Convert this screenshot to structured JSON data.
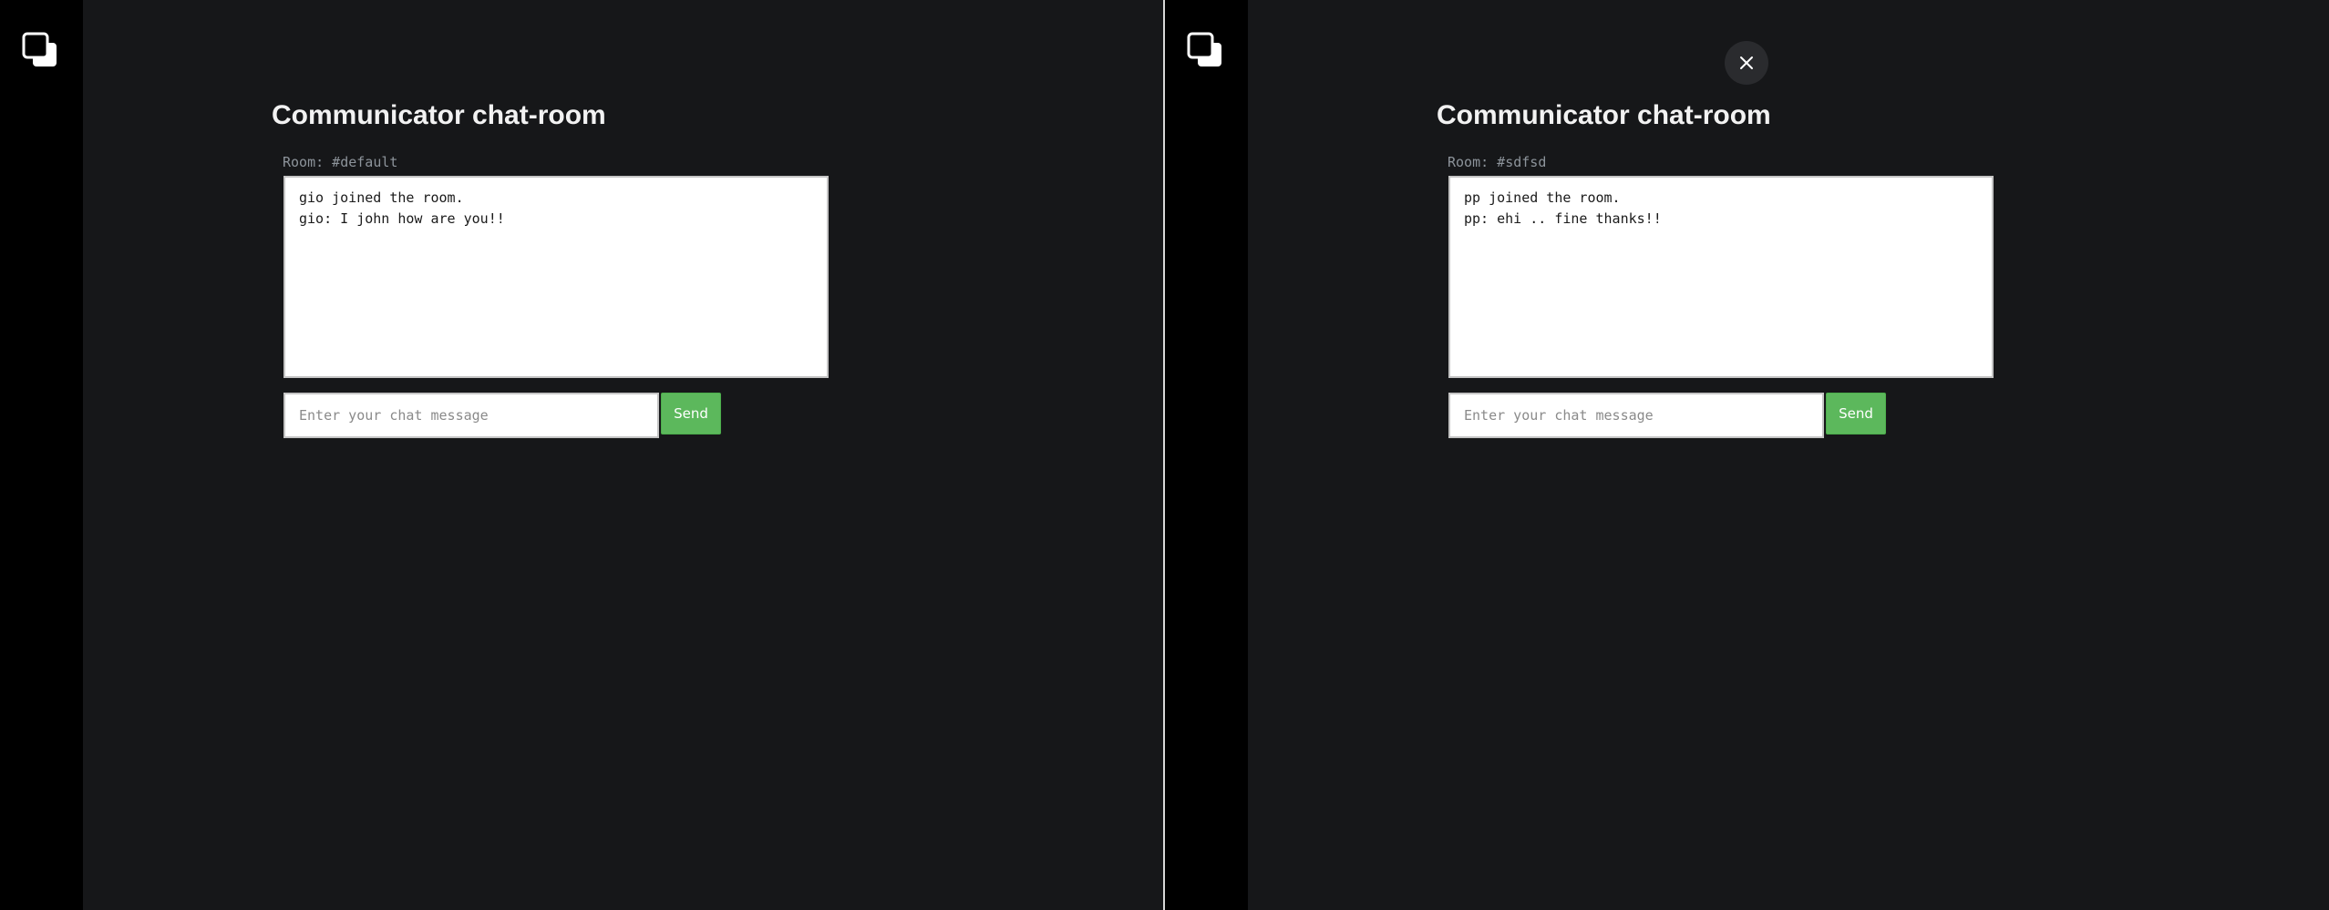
{
  "colors": {
    "background": "#161719",
    "sidebar": "#000000",
    "send_button": "#5cb85c",
    "title_text": "#f2f2f2",
    "room_label_text": "#8d949b"
  },
  "left_panel": {
    "logo_icon": "overlapping-squares-icon",
    "title": "Communicator chat-room",
    "room_label": "Room: #default",
    "messages": [
      "gio joined the room.",
      "gio: I john how are you!!"
    ],
    "input": {
      "value": "",
      "placeholder": "Enter your chat message"
    },
    "send_label": "Send"
  },
  "right_panel": {
    "logo_icon": "overlapping-squares-icon",
    "close_icon": "close-icon",
    "title": "Communicator chat-room",
    "room_label": "Room: #sdfsd",
    "messages": [
      "pp joined the room.",
      "pp: ehi .. fine thanks!!"
    ],
    "input": {
      "value": "",
      "placeholder": "Enter your chat message"
    },
    "send_label": "Send"
  }
}
